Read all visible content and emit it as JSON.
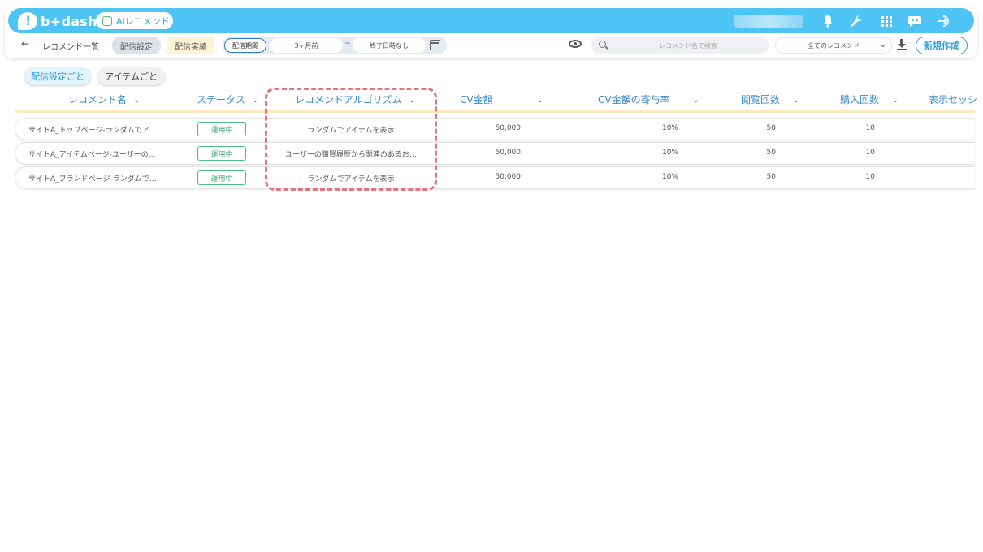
{
  "header": {
    "logo_text": "b+dash",
    "product_label": "AIレコメンド",
    "icons": [
      "bell-icon",
      "wrench-icon",
      "grid-icon",
      "chat-bot-icon",
      "logout-icon"
    ]
  },
  "toolbar": {
    "back_arrow": "←",
    "breadcrumb": "レコメンド一覧",
    "tab_settings": "配信設定",
    "tab_results": "配信実績",
    "period_label": "配信期間",
    "period_from": "3ヶ月前",
    "period_tilde": "~",
    "period_to": "終了日時なし",
    "search_placeholder": "レコメンド名で検索",
    "filter_selected": "全てのレコメンド",
    "new_button": "新規作成"
  },
  "view_tabs": {
    "by_setting": "配信設定ごと",
    "by_item": "アイテムごと"
  },
  "table": {
    "columns": {
      "name": "レコメンド名",
      "status": "ステータス",
      "algorithm": "レコメンドアルゴリズム",
      "cv_amount": "CV金額",
      "cv_contribution": "CV金額の寄与率",
      "views": "閲覧回数",
      "purchases": "購入回数",
      "sessions": "表示セッシ"
    },
    "rows": [
      {
        "name": "サイトA_トップページ-ランダムでア…",
        "status": "運用中",
        "algorithm": "ランダムでアイテムを表示",
        "cv_amount": "50,000",
        "cv_contribution": "10%",
        "views": "50",
        "purchases": "10"
      },
      {
        "name": "サイトA_アイテムページ-ユーザーの…",
        "status": "運用中",
        "algorithm": "ユーザーの購買履歴から関連のあるお…",
        "cv_amount": "50,000",
        "cv_contribution": "10%",
        "views": "50",
        "purchases": "10"
      },
      {
        "name": "サイトA_ブランドページ-ランダムで…",
        "status": "運用中",
        "algorithm": "ランダムでアイテムを表示",
        "cv_amount": "50,000",
        "cv_contribution": "10%",
        "views": "50",
        "purchases": "10"
      }
    ]
  },
  "colors": {
    "brand": "#4dc4f4",
    "status_green": "#4cbc8a",
    "highlight_red": "#e8737c",
    "header_accent": "#fde9bf"
  }
}
